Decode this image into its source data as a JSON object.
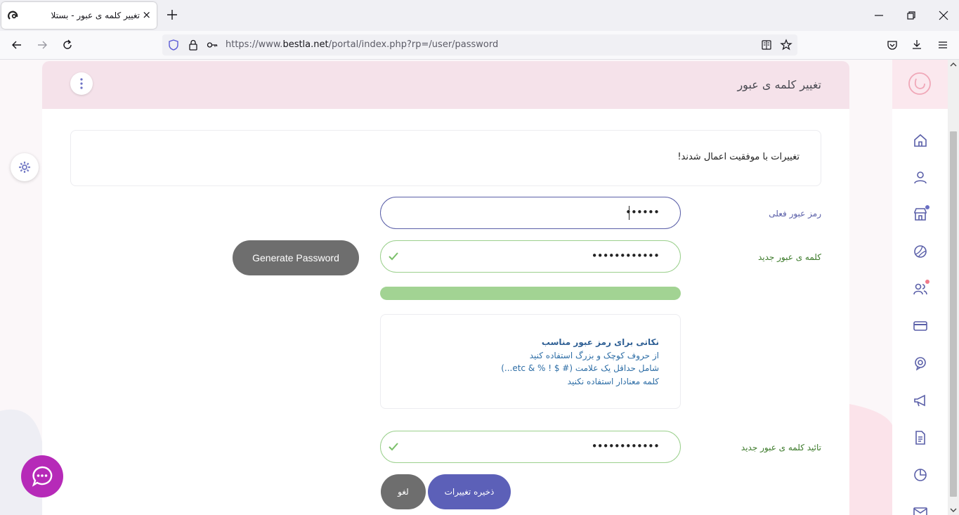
{
  "browser": {
    "tab_title": "تغییر کلمه ی عبور - بستلا",
    "tab_close": "×",
    "url_prefix": "https://www.",
    "url_domain": "bestla.net",
    "url_path": "/portal/index.php?rp=/user/password"
  },
  "header": {
    "title": "تغییر کلمه ی عبور"
  },
  "alert": {
    "message": "تغییرات با موفقیت اعمال شدند!"
  },
  "form": {
    "current_password_label": "رمز عبور فعلی",
    "current_password_value": "••••••",
    "new_password_label": "کلمه ی عبور جدید",
    "new_password_value": "••••••••••••",
    "confirm_password_label": "تائید کلمه ی عبور جدید",
    "confirm_password_value": "••••••••••••",
    "password_strength": 1.0,
    "generate_button": "Generate Password",
    "save_button": "ذخیره تغییرات",
    "cancel_button": "لغو"
  },
  "tips": {
    "title": "نکاتی برای رمز عبور مناسب",
    "items": [
      "از حروف کوچک و بزرگ استفاده کنید",
      "شامل حداقل یک علامت (# $ ! % & etc...)",
      "کلمه معنادار استفاده نکنید"
    ]
  },
  "sidebar": {
    "icons": [
      "home-icon",
      "user-icon",
      "store-icon",
      "domain-icon",
      "users-icon",
      "billing-card-icon",
      "support-icon",
      "announcements-icon",
      "document-icon",
      "report-icon",
      "mail-icon"
    ]
  },
  "colors": {
    "accent": "#5c60b8",
    "success": "#9bd08d",
    "header_bg": "#f5e2ea",
    "chat": "#b62ab8",
    "sidebar_icon": "#5a5fa8"
  }
}
